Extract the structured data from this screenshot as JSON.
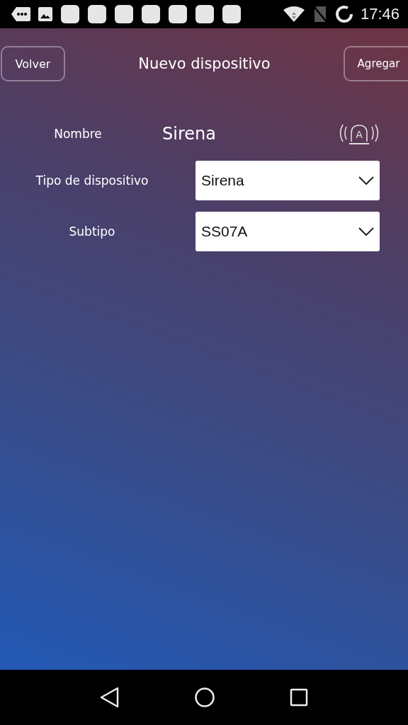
{
  "status_bar": {
    "time": "17:46"
  },
  "header": {
    "back_button": "Volver",
    "title": "Nuevo dispositivo",
    "add_button": "Agregar"
  },
  "form": {
    "name": {
      "label": "Nombre",
      "value": "Sirena",
      "icon_letter": "A"
    },
    "fields": [
      {
        "label": "Tipo de dispositivo",
        "value": "Sirena"
      },
      {
        "label": "Subtipo",
        "value": "SS07A"
      }
    ]
  }
}
